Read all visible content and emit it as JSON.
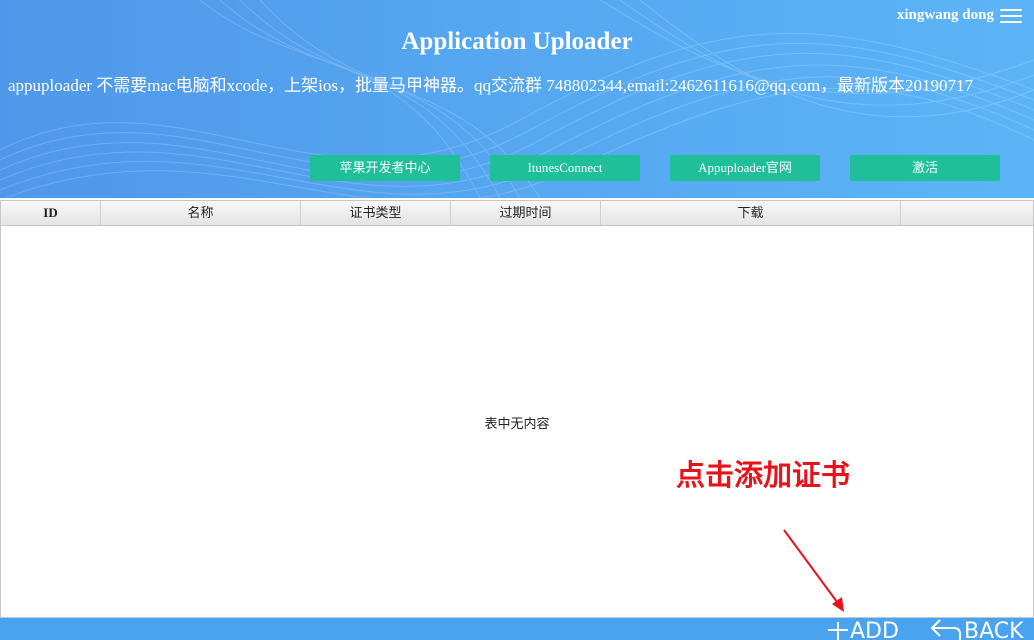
{
  "header": {
    "user_name": "xingwang dong",
    "title": "Application Uploader",
    "description": "appuploader 不需要mac电脑和xcode，上架ios，批量马甲神器。qq交流群 748802344,email:2462611616@qq.com，最新版本20190717",
    "buttons": [
      {
        "label": "苹果开发者中心"
      },
      {
        "label": "ItunesConnect"
      },
      {
        "label": "Appuploader官网"
      },
      {
        "label": "激活"
      }
    ]
  },
  "table": {
    "columns": [
      "ID",
      "名称",
      "证书类型",
      "过期时间",
      "下载",
      ""
    ],
    "empty_text": "表中无内容"
  },
  "annotation": {
    "text": "点击添加证书",
    "color": "#e8121b"
  },
  "footer": {
    "add_label": "ADD",
    "back_label": "BACK"
  },
  "colors": {
    "header_blue": "#4f97ea",
    "button_teal": "#1fbf9a",
    "footer_blue": "#4aa3ee"
  },
  "icons": {
    "menu": "hamburger-icon",
    "add": "plus-icon",
    "back": "back-arrow-icon"
  }
}
